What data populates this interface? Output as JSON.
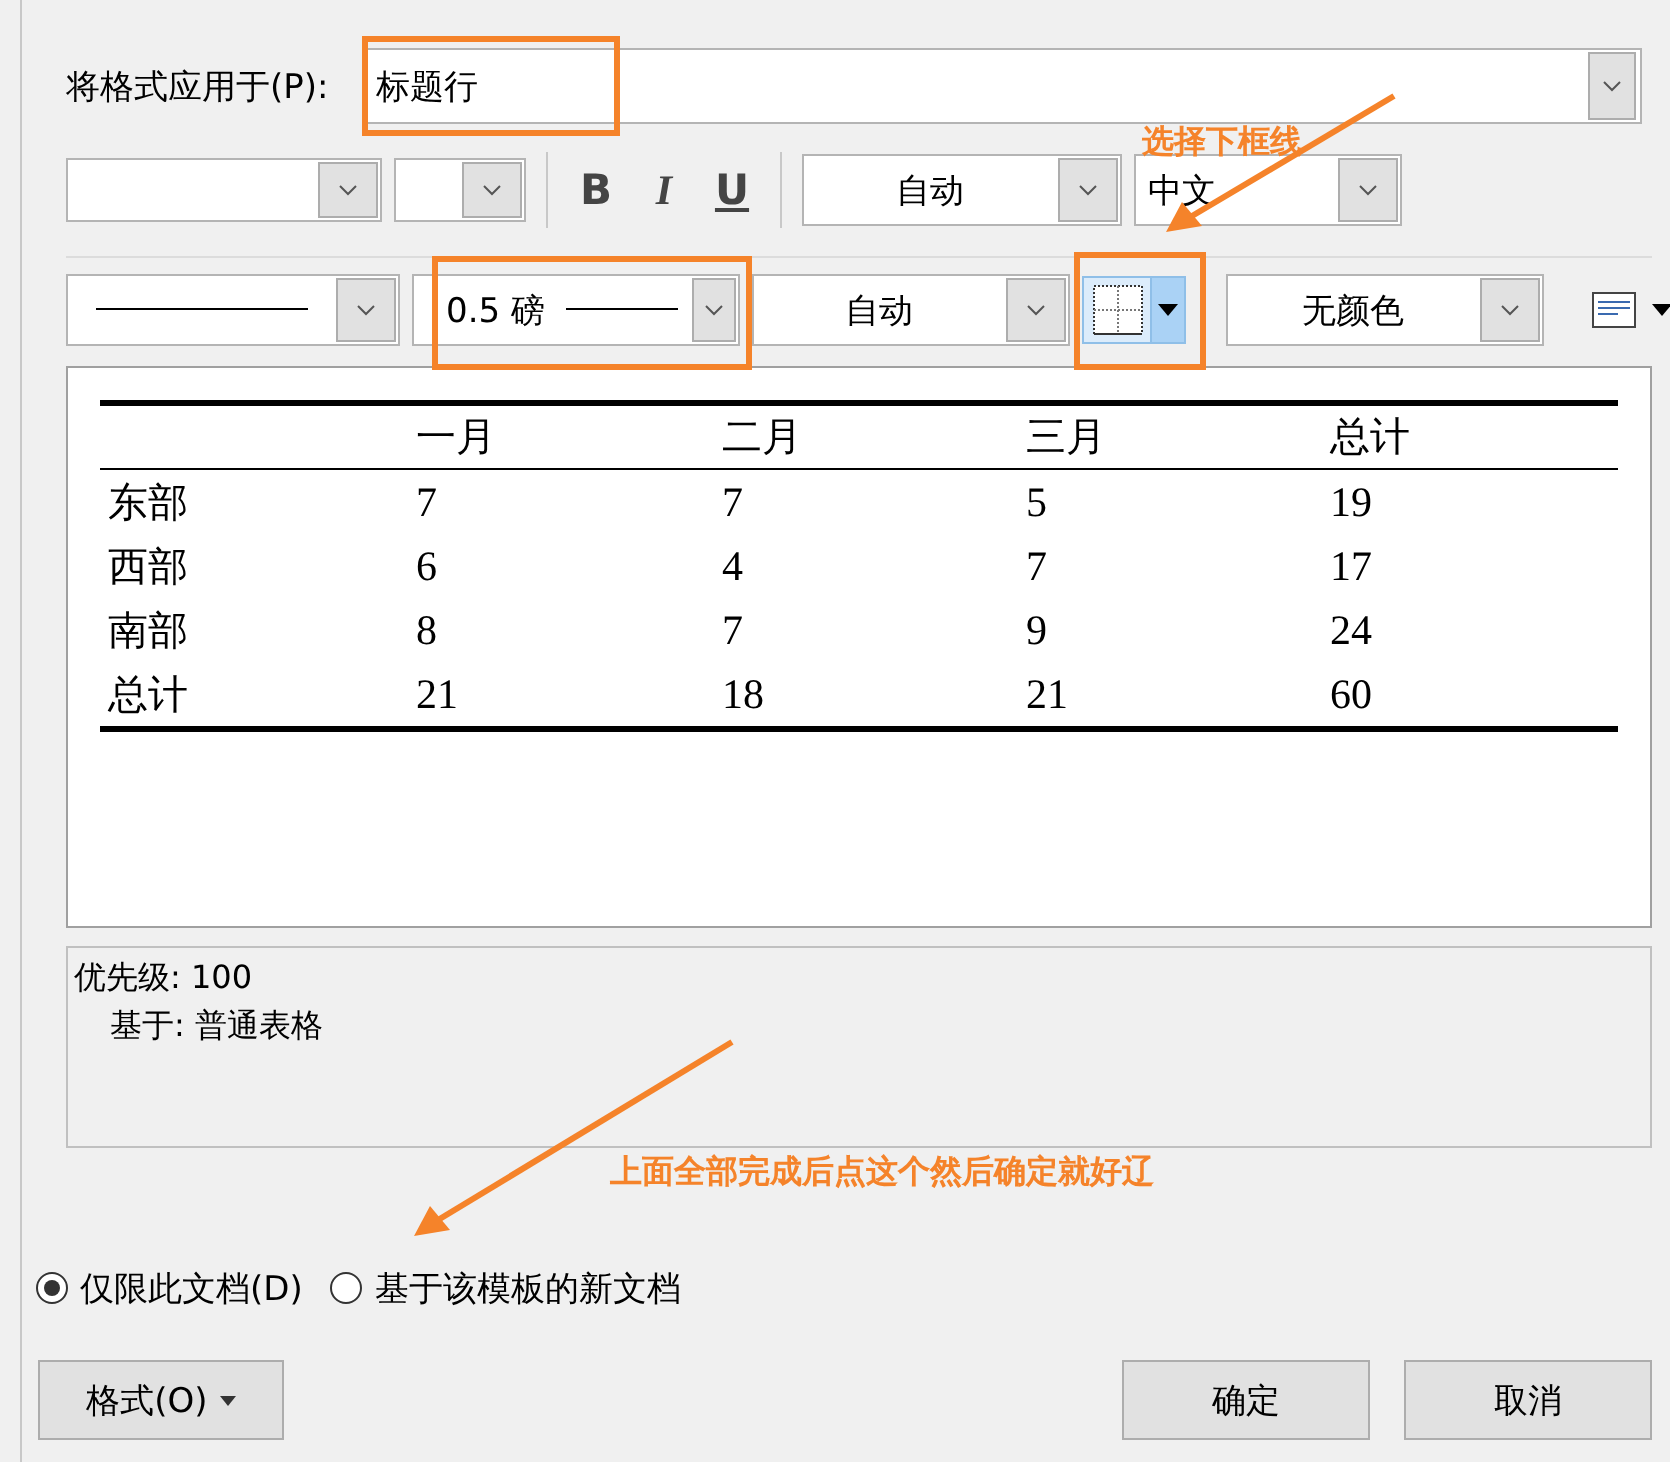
{
  "apply_to": {
    "label": "将格式应用于(P):",
    "value": "标题行"
  },
  "font_toolbar": {
    "bold": "B",
    "italic": "I",
    "underline": "U",
    "font_color": "自动",
    "language": "中文"
  },
  "border_toolbar": {
    "line_weight": "0.5 磅",
    "border_color": "自动",
    "shading": "无颜色"
  },
  "preview_table": {
    "columns": [
      "一月",
      "二月",
      "三月",
      "总计"
    ],
    "rows": [
      {
        "label": "东部",
        "values": [
          "7",
          "7",
          "5",
          "19"
        ]
      },
      {
        "label": "西部",
        "values": [
          "6",
          "4",
          "7",
          "17"
        ]
      },
      {
        "label": "南部",
        "values": [
          "8",
          "7",
          "9",
          "24"
        ]
      },
      {
        "label": "总计",
        "values": [
          "21",
          "18",
          "21",
          "60"
        ]
      }
    ]
  },
  "description": {
    "priority": "优先级: 100",
    "based_on": "基于: 普通表格"
  },
  "scope": [
    {
      "label": "仅限此文档(D)",
      "selected": true
    },
    {
      "label": "基于该模板的新文档",
      "selected": false
    }
  ],
  "buttons": [
    {
      "label": "格式(O)",
      "kind": "menu"
    },
    {
      "label": "确定",
      "kind": "plain"
    },
    {
      "label": "取消",
      "kind": "plain"
    }
  ],
  "annotations": [
    {
      "text": "选择下框线"
    },
    {
      "text": "上面全部完成后点这个然后确定就好辽"
    }
  ]
}
